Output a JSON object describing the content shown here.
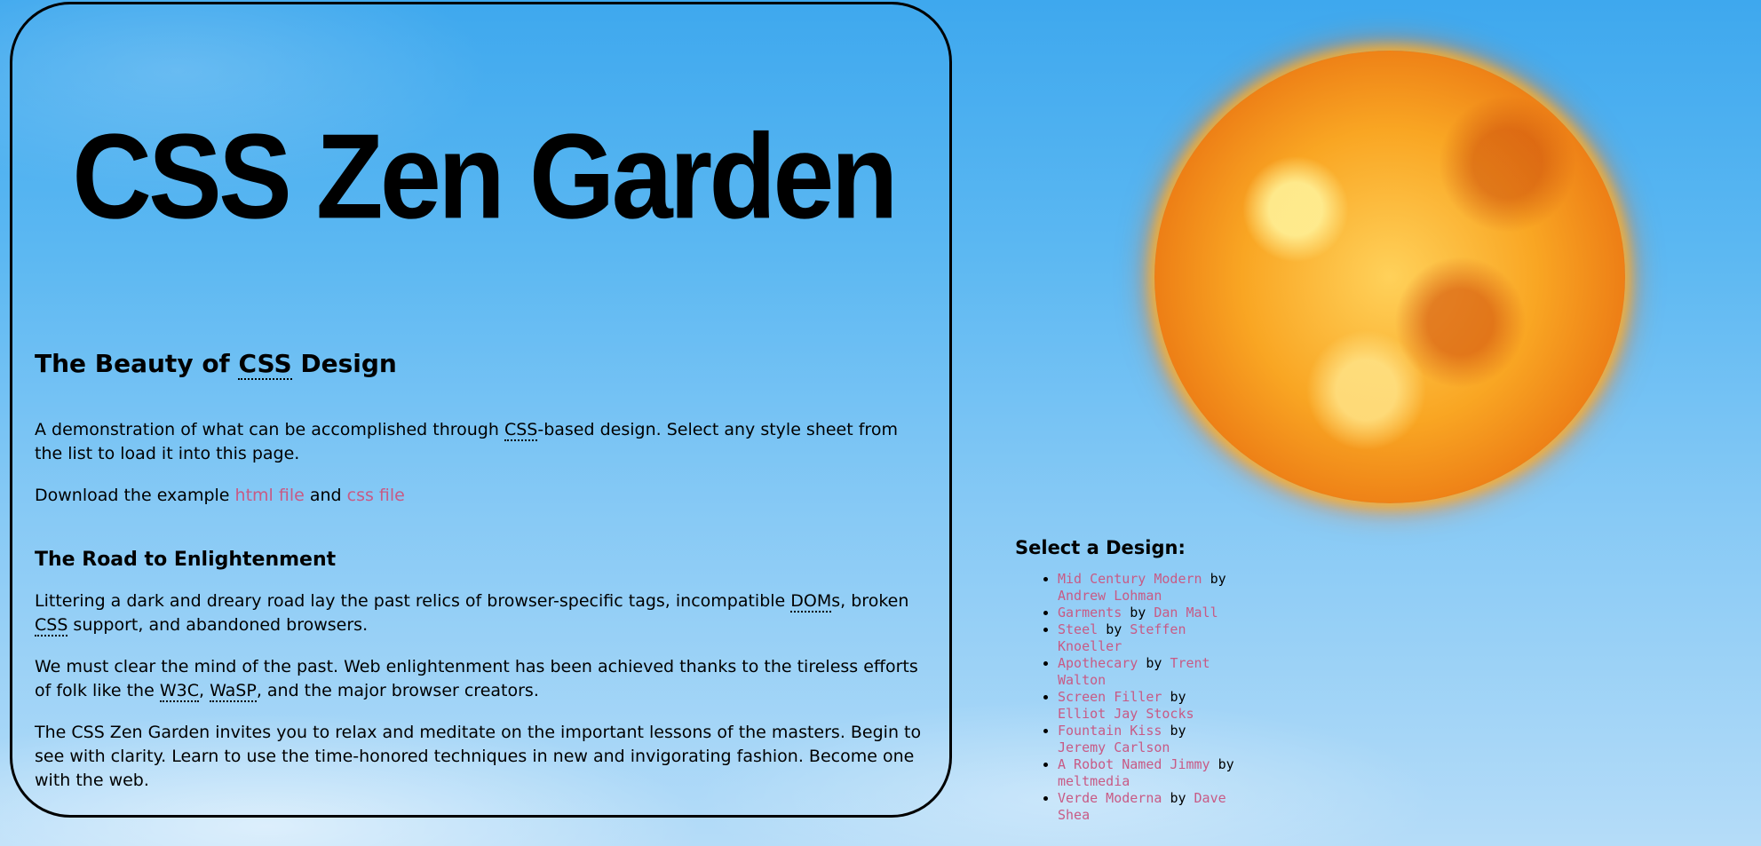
{
  "header": {
    "title": "CSS Zen Garden"
  },
  "intro": {
    "heading_pre": "The Beauty of ",
    "heading_abbr": "CSS",
    "heading_post": " Design",
    "p1_pre": "A demonstration of what can be accomplished through ",
    "p1_abbr": "CSS",
    "p1_post": "-based design. Select any style sheet from the list to load it into this page.",
    "p2_pre": "Download the example ",
    "html_link": "html file",
    "p2_and": " and ",
    "css_link": "css file"
  },
  "enlightenment": {
    "heading": "The Road to Enlightenment",
    "p1_a": "Littering a dark and dreary road lay the past relics of browser-specific tags, incompatible ",
    "p1_abbr1": "DOM",
    "p1_b": "s, broken ",
    "p1_abbr2": "CSS",
    "p1_c": " support, and abandoned browsers.",
    "p2_a": "We must clear the mind of the past. Web enlightenment has been achieved thanks to the tireless efforts of folk like the ",
    "p2_abbr1": "W3C",
    "p2_b": ", ",
    "p2_abbr2": "WaSP",
    "p2_c": ", and the major browser creators.",
    "p3": "The CSS Zen Garden invites you to relax and meditate on the important lessons of the masters. Begin to see with clarity. Learn to use the time-honored techniques in new and invigorating fashion. Become one with the web."
  },
  "sidebar": {
    "title": "Select a Design:",
    "by_word": "by",
    "designs": [
      {
        "name": "Mid Century Modern",
        "author": "Andrew Lohman"
      },
      {
        "name": "Garments",
        "author": "Dan Mall"
      },
      {
        "name": "Steel",
        "author": "Steffen Knoeller"
      },
      {
        "name": "Apothecary",
        "author": "Trent Walton"
      },
      {
        "name": "Screen Filler",
        "author": "Elliot Jay Stocks"
      },
      {
        "name": "Fountain Kiss",
        "author": "Jeremy Carlson"
      },
      {
        "name": "A Robot Named Jimmy",
        "author": "meltmedia"
      },
      {
        "name": "Verde Moderna",
        "author": "Dave Shea"
      }
    ]
  },
  "colors": {
    "link": "#c85a85",
    "sky_top": "#3ea8ee",
    "sky_bottom": "#b5dcf8"
  },
  "icons": {
    "sun": "sun-illustration"
  }
}
